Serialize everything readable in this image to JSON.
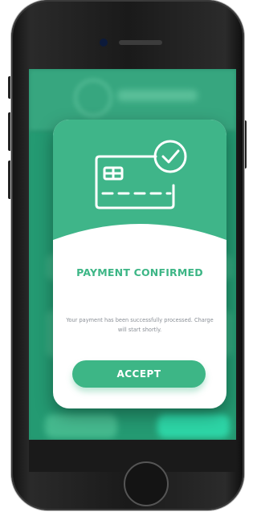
{
  "colors": {
    "accent": "#3db686",
    "modal_header": "#3fb589",
    "message_text": "#8a8f96",
    "button_text": "#ffffff"
  },
  "modal": {
    "icon": "credit-card-check-icon",
    "title": "PAYMENT CONFIRMED",
    "message": "Your payment has been successfully processed. Charge will start shortly.",
    "accept_label": "ACCEPT"
  }
}
